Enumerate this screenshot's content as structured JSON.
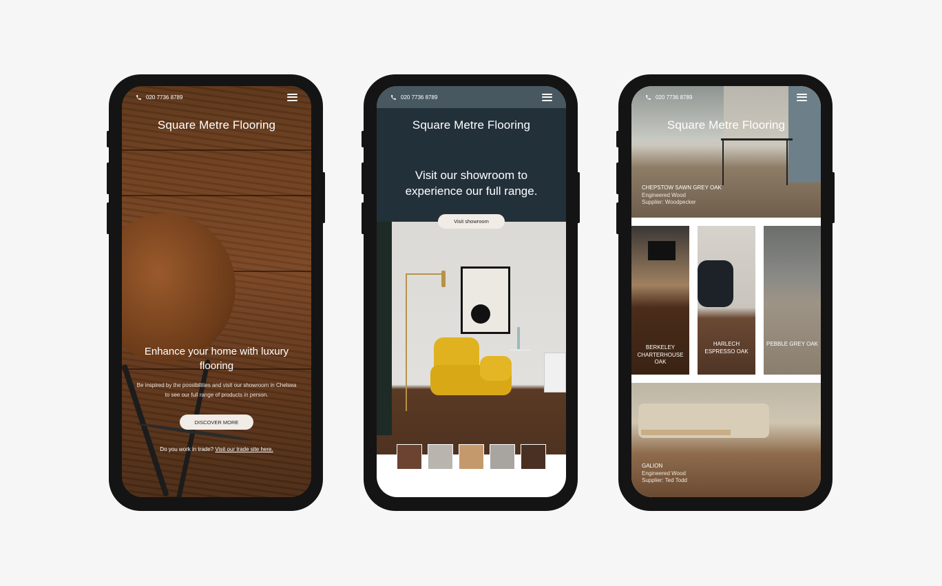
{
  "common": {
    "phone_number": "020 7736 8789",
    "brand": "Square Metre Flooring"
  },
  "screen1": {
    "hero_title": "Enhance your home with luxury flooring",
    "hero_text": "Be inspired by the possibilities and visit our showroom in Chelsea to see our full range of products in person.",
    "cta": "DISCOVER MORE",
    "trade_prefix": "Do you work in trade?",
    "trade_link": "Visit our trade site here."
  },
  "screen2": {
    "headline": "Visit our showroom to experience our full range.",
    "cta": "Visit showroom",
    "swatch_colors": [
      "#6b4330",
      "#b9b5ae",
      "#c49a6c",
      "#a8a5a0",
      "#4a3022"
    ]
  },
  "screen3": {
    "featured_top": {
      "name": "CHEPSTOW SAWN GREY OAK",
      "type": "Engineered Wood",
      "supplier": "Supplier: Woodpecker"
    },
    "grid": [
      {
        "name": "BERKELEY CHARTERHOUSE OAK"
      },
      {
        "name": "HARLECH ESPRESSO OAK"
      },
      {
        "name": "PEBBLE GREY OAK"
      }
    ],
    "featured_bottom": {
      "name": "GALION",
      "type": "Engineered Wood",
      "supplier": "Supplier: Ted Todd"
    }
  },
  "colors": {
    "page_bg": "#f6f6f6",
    "phone_frame": "#141414",
    "navy_band": "#22303a",
    "pill_bg": "#f1ece6"
  }
}
